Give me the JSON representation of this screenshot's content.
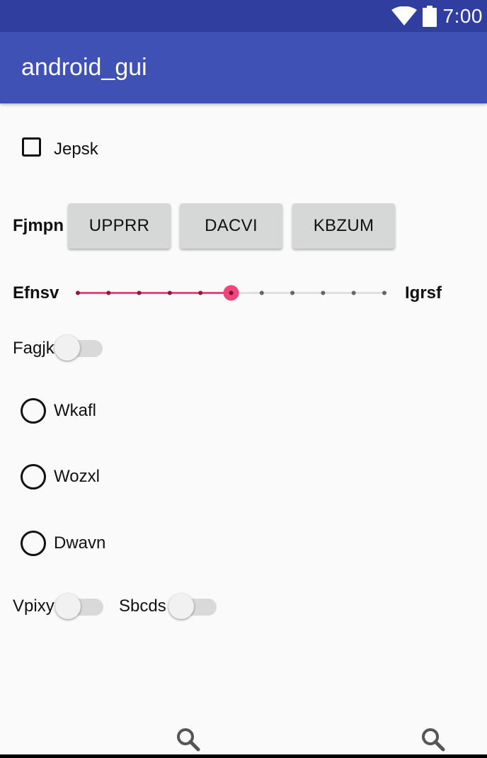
{
  "status_bar": {
    "time": "7:00",
    "wifi_icon": "wifi-icon",
    "battery_icon": "battery-icon"
  },
  "app_bar": {
    "title": "android_gui"
  },
  "checkbox": {
    "label": "Jepsk",
    "checked": false
  },
  "button_row": {
    "label": "Fjmpn",
    "buttons": [
      "UPPRR",
      "DACVI",
      "KBZUM"
    ]
  },
  "slider": {
    "left_label": "Efnsv",
    "right_label": "Igrsf",
    "step_count": 10,
    "value_step": 5,
    "accent_color": "#f0457a"
  },
  "switch_1": {
    "label": "Fagjk",
    "on": false
  },
  "radios": [
    {
      "label": "Wkafl",
      "selected": false
    },
    {
      "label": "Wozxl",
      "selected": false
    },
    {
      "label": "Dwavn",
      "selected": false
    }
  ],
  "switch_row": [
    {
      "label": "Vpixy",
      "on": false
    },
    {
      "label": "Sbcds",
      "on": false
    }
  ],
  "bottom_icons": [
    "search-icon",
    "search-icon"
  ],
  "colors": {
    "status_bar": "#303f9f",
    "app_bar": "#3f51b5"
  }
}
